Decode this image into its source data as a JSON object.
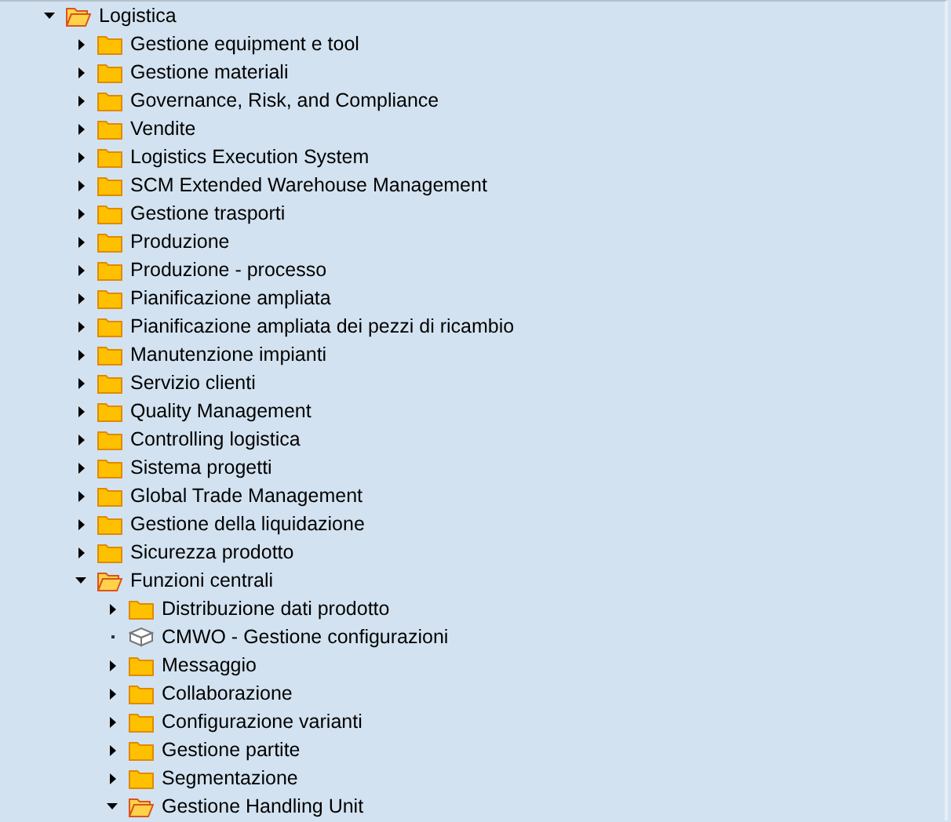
{
  "tree": {
    "label": "Logistica",
    "kind": "folder",
    "expanded": true,
    "children": [
      {
        "label": "Gestione equipment e tool",
        "kind": "folder",
        "expanded": false
      },
      {
        "label": "Gestione materiali",
        "kind": "folder",
        "expanded": false
      },
      {
        "label": "Governance, Risk, and Compliance",
        "kind": "folder",
        "expanded": false
      },
      {
        "label": "Vendite",
        "kind": "folder",
        "expanded": false
      },
      {
        "label": "Logistics Execution System",
        "kind": "folder",
        "expanded": false
      },
      {
        "label": "SCM Extended Warehouse Management",
        "kind": "folder",
        "expanded": false
      },
      {
        "label": "Gestione trasporti",
        "kind": "folder",
        "expanded": false
      },
      {
        "label": "Produzione",
        "kind": "folder",
        "expanded": false
      },
      {
        "label": "Produzione - processo",
        "kind": "folder",
        "expanded": false
      },
      {
        "label": "Pianificazione ampliata",
        "kind": "folder",
        "expanded": false
      },
      {
        "label": "Pianificazione ampliata dei pezzi di ricambio",
        "kind": "folder",
        "expanded": false
      },
      {
        "label": "Manutenzione impianti",
        "kind": "folder",
        "expanded": false
      },
      {
        "label": "Servizio clienti",
        "kind": "folder",
        "expanded": false
      },
      {
        "label": "Quality Management",
        "kind": "folder",
        "expanded": false
      },
      {
        "label": "Controlling logistica",
        "kind": "folder",
        "expanded": false
      },
      {
        "label": "Sistema progetti",
        "kind": "folder",
        "expanded": false
      },
      {
        "label": "Global Trade Management",
        "kind": "folder",
        "expanded": false
      },
      {
        "label": "Gestione della liquidazione",
        "kind": "folder",
        "expanded": false
      },
      {
        "label": "Sicurezza prodotto",
        "kind": "folder",
        "expanded": false
      },
      {
        "label": "Funzioni centrali",
        "kind": "folder",
        "expanded": true,
        "children": [
          {
            "label": "Distribuzione dati prodotto",
            "kind": "folder",
            "expanded": false
          },
          {
            "label": "CMWO - Gestione configurazioni",
            "kind": "transaction"
          },
          {
            "label": "Messaggio",
            "kind": "folder",
            "expanded": false
          },
          {
            "label": "Collaborazione",
            "kind": "folder",
            "expanded": false
          },
          {
            "label": "Configurazione varianti",
            "kind": "folder",
            "expanded": false
          },
          {
            "label": "Gestione partite",
            "kind": "folder",
            "expanded": false
          },
          {
            "label": "Segmentazione",
            "kind": "folder",
            "expanded": false
          },
          {
            "label": "Gestione Handling Unit",
            "kind": "folder",
            "expanded": true
          }
        ]
      }
    ]
  }
}
